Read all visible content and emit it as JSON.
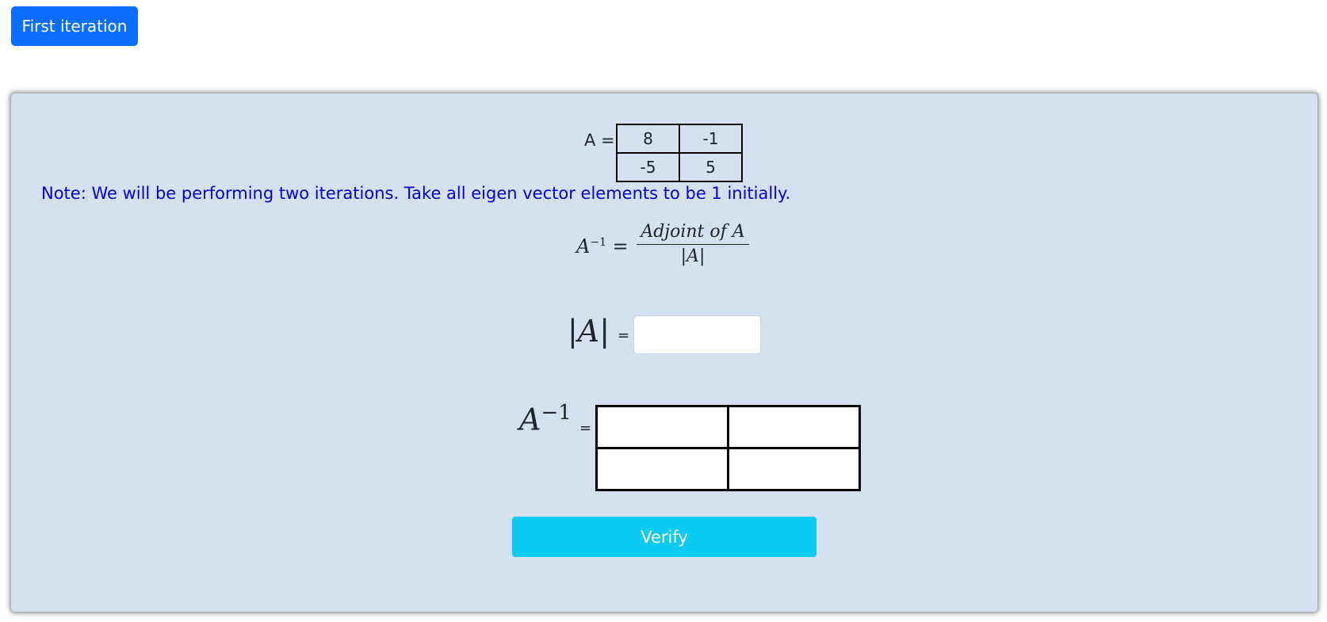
{
  "header": {
    "iteration_button_label": "First iteration"
  },
  "matrix_a": {
    "label": "A =",
    "rows": [
      [
        "8",
        "-1"
      ],
      [
        "-5",
        "5"
      ]
    ]
  },
  "note": "Note: We will be performing two iterations. Take all eigen vector elements to be 1 initially.",
  "formula": {
    "lhs_base": "A",
    "lhs_exp": "−1",
    "eq": "=",
    "numerator": "Adjoint of A",
    "denominator": "|A|"
  },
  "determinant": {
    "label": "|A|",
    "eq": "=",
    "value": "",
    "placeholder": ""
  },
  "inverse": {
    "label_base": "A",
    "label_exp": "−1",
    "eq": "=",
    "cells": [
      [
        "",
        ""
      ],
      [
        "",
        ""
      ]
    ]
  },
  "actions": {
    "verify_label": "Verify"
  },
  "colors": {
    "primary_button": "#0d6efd",
    "panel_background": "#d5e0f1",
    "note_text": "#0000dd",
    "verify_button": "#0dcaf0"
  }
}
